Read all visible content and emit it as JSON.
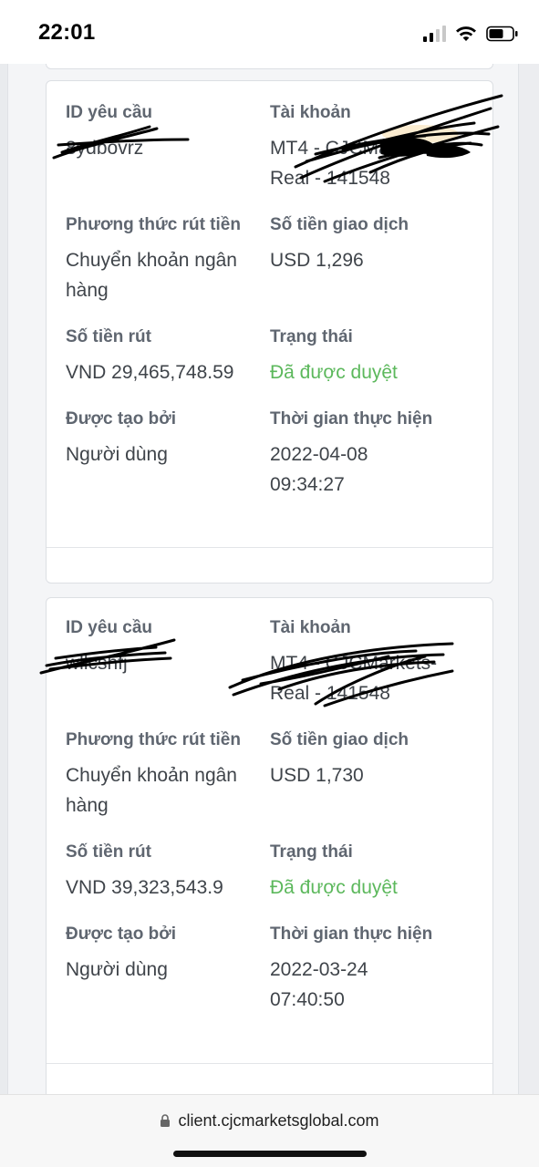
{
  "status_bar": {
    "time": "22:01",
    "icons": [
      "cellular-signal-icon",
      "wifi-icon",
      "battery-icon"
    ]
  },
  "colors": {
    "approved": "#5cb85c",
    "label": "#5f6670",
    "value": "#3f444a",
    "card_border": "#dcdfe3"
  },
  "withdrawals": [
    {
      "request_id_label": "ID yêu cầu",
      "request_id": "8ydbovrz",
      "account_label": "Tài khoản",
      "account": "MT4 - CJCMarkets-Real - 141548",
      "method_label": "Phương thức rút tiền",
      "method": "Chuyển khoản ngân hàng",
      "transaction_amount_label": "Số tiền giao dịch",
      "transaction_amount": "USD 1,296",
      "withdraw_amount_label": "Số tiền rút",
      "withdraw_amount": "VND 29,465,748.59",
      "status_label": "Trạng thái",
      "status": "Đã được duyệt",
      "created_by_label": "Được tạo bởi",
      "created_by": "Người dùng",
      "executed_time_label": "Thời gian thực hiện",
      "executed_time": "2022-04-08 09:34:27"
    },
    {
      "request_id_label": "ID yêu cầu",
      "request_id": "wllcshfj",
      "account_label": "Tài khoản",
      "account": "MT4 - CJCMarkets-Real - 141548",
      "method_label": "Phương thức rút tiền",
      "method": "Chuyển khoản ngân hàng",
      "transaction_amount_label": "Số tiền giao dịch",
      "transaction_amount": "USD 1,730",
      "withdraw_amount_label": "Số tiền rút",
      "withdraw_amount": "VND 39,323,543.9",
      "status_label": "Trạng thái",
      "status": "Đã được duyệt",
      "created_by_label": "Được tạo bởi",
      "created_by": "Người dùng",
      "executed_time_label": "Thời gian thực hiện",
      "executed_time": "2022-03-24 07:40:50"
    }
  ],
  "browser": {
    "url": "client.cjcmarketsglobal.com"
  }
}
